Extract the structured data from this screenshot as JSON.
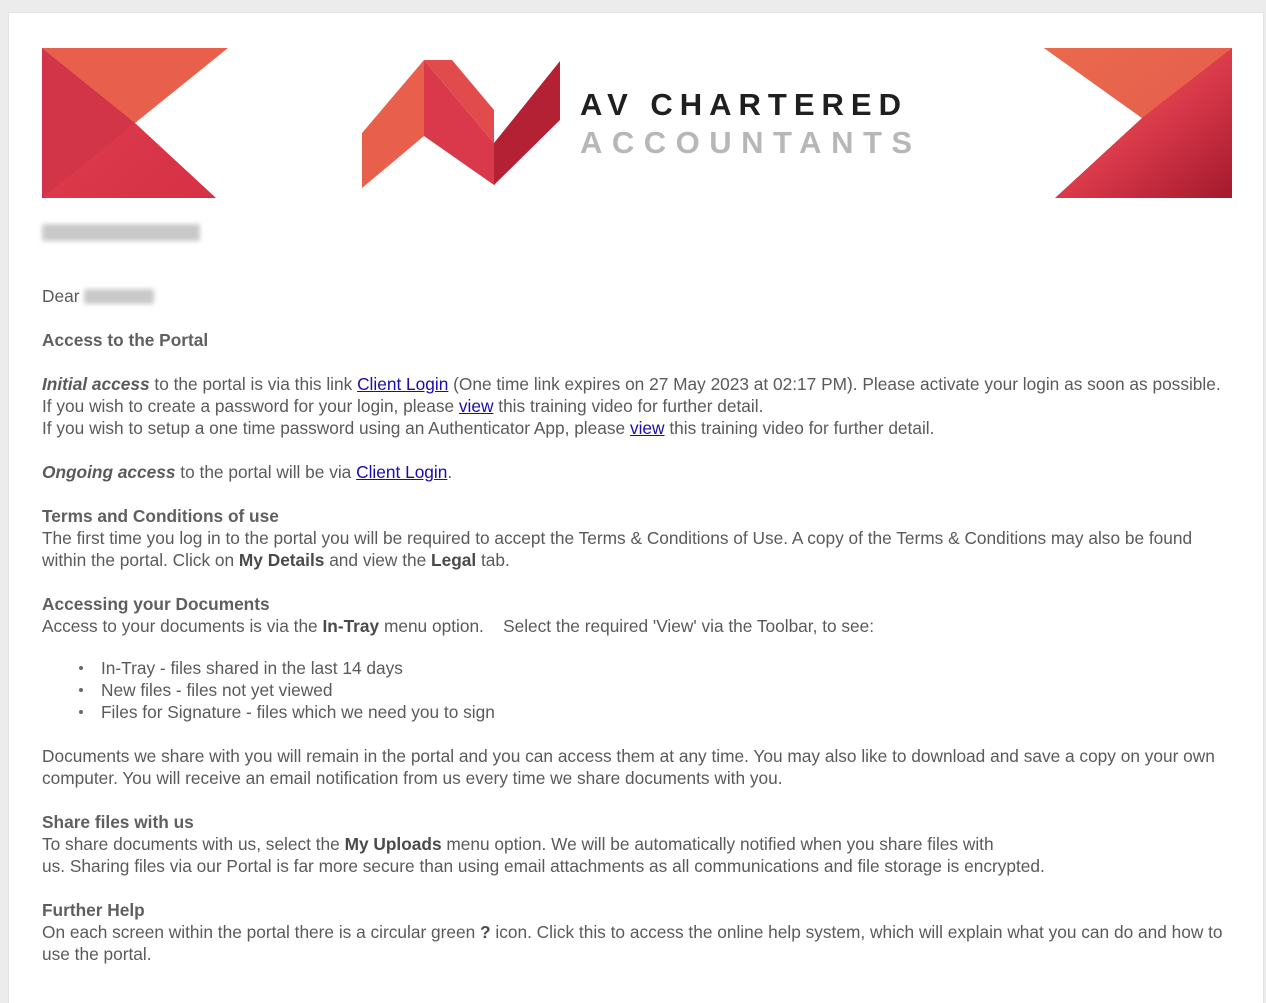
{
  "brand": {
    "line1": "AV CHARTERED",
    "line2": "ACCOUNTANTS",
    "colors": {
      "red": "#d9394a",
      "orange": "#e8604c",
      "dark_red": "#a4192d",
      "text_dark": "#1f1f1f",
      "text_light": "#b7b7b7"
    }
  },
  "greeting": {
    "dear": "Dear"
  },
  "access": {
    "title": "Access to the Portal",
    "initial_label": "Initial access",
    "initial_text_a": " to the portal is via this link ",
    "client_login": "Client Login",
    "initial_text_b": " (One time link expires on 27 May 2023 at 02:17 PM). Please activate your login as soon as possible.",
    "password_a": "If you wish to create a password for your login, please ",
    "view": "view",
    "password_b": " this training video for further detail.",
    "otp_a": "If you wish to setup a one time password using an Authenticator App, please ",
    "otp_b": " this training video for further detail.",
    "ongoing_label": "Ongoing access",
    "ongoing_text": " to the portal will be via ",
    "period": "."
  },
  "terms": {
    "title": "Terms and Conditions of use",
    "text_a": "The first time you log in to the portal you will be required to accept the Terms & Conditions of Use.  A copy of the Terms & Conditions may also be found within the portal. Click on ",
    "my_details": "My Details",
    "text_b": " and view the ",
    "legal": "Legal",
    "text_c": " tab."
  },
  "documents": {
    "title": "Accessing your Documents",
    "text_a": "Access to your documents is via the ",
    "in_tray": "In-Tray",
    "text_b": " menu option.    Select the required 'View' via the Toolbar, to see:",
    "items": [
      "In-Tray -  files shared in the last 14 days",
      "New files -  files not yet viewed",
      "Files for Signature - files which we need you to sign"
    ],
    "paragraph": "Documents we share with you will remain in the portal and you can access them at any time. You may also like to download and save a copy on your own computer.   You will receive an email notification from us every time we share documents with you."
  },
  "share": {
    "title": "Share files with us",
    "text_a": "To share documents with us, select the ",
    "my_uploads": "My Uploads",
    "text_b": " menu option.  We will be automatically notified when you share files with",
    "text_c": "us. Sharing files via our Portal is far more secure than using email attachments as all communications and file storage is encrypted."
  },
  "help": {
    "title": "Further Help",
    "text_a": "On each screen within the portal there is a circular green ",
    "q": "?",
    "text_b": " icon.  Click this to access the online help system, which will explain what you can do and how to use the portal."
  }
}
